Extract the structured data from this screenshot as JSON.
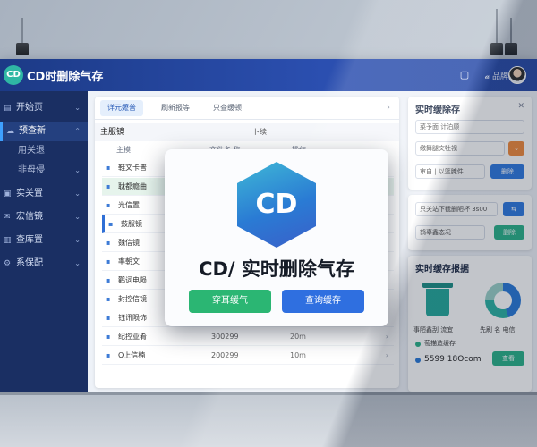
{
  "app": {
    "logo": "CD",
    "title": "CD时删除气存"
  },
  "topbar": {
    "user": "𝓪 品牌"
  },
  "sidebar": {
    "items": [
      {
        "label": "开始页",
        "icon": "document-icon"
      },
      {
        "label": "预查新",
        "icon": "cloud-icon",
        "active": true
      },
      {
        "label": "用关退",
        "icon": "",
        "sub": true
      },
      {
        "label": "非母侵",
        "icon": "",
        "sub": true
      },
      {
        "label": "实关置",
        "icon": "server-icon"
      },
      {
        "label": "宏信镜",
        "icon": "mail-icon"
      },
      {
        "label": "查库置",
        "icon": "chart-icon"
      },
      {
        "label": "系保配",
        "icon": "settings-icon"
      }
    ],
    "bottom_icon": "collapse-icon"
  },
  "main": {
    "tabs": [
      {
        "label": "详元嬷普",
        "active": true
      },
      {
        "label": "刷新报等"
      },
      {
        "label": "只查缓顿"
      }
    ],
    "subhead": {
      "title": "主服镜",
      "right": "卜续"
    },
    "columns": [
      "主模",
      "文件名 称",
      "操作"
    ],
    "rows": [
      {
        "name": "鞋文卡普",
        "n1": "",
        "n2": "",
        "style": "normal"
      },
      {
        "name": "耽都瘾曲",
        "n1": "",
        "n2": "",
        "style": "highlight"
      },
      {
        "name": "光信置",
        "n1": "",
        "n2": "",
        "style": "normal"
      },
      {
        "name": "鼓服镜",
        "n1": "",
        "n2": "",
        "style": "selected"
      },
      {
        "name": "魏信镜",
        "n1": "",
        "n2": "",
        "style": "normal"
      },
      {
        "name": "率朝文",
        "n1": "",
        "n2": "",
        "style": "normal"
      },
      {
        "name": "鹳词电陨",
        "n1": "",
        "n2": "",
        "style": "normal"
      },
      {
        "name": "封控信镜",
        "n1": "",
        "n2": "",
        "style": "normal"
      },
      {
        "name": "钰讯陨饰",
        "n1": "300299",
        "n2": "20m",
        "style": "normal"
      },
      {
        "name": "纪控亚肴",
        "n1": "300299",
        "n2": "20m",
        "style": "normal"
      },
      {
        "name": "O上信楠",
        "n1": "200299",
        "n2": "10m",
        "style": "normal"
      }
    ]
  },
  "panel1": {
    "title": "实时缓除存",
    "input1": "菜予面 计泊顾",
    "input2": "缴舞腿文牡视",
    "input3": "审自 | 以篮腌件",
    "btn": "删除",
    "accent": "#2f7ae0",
    "orange": "#f08a3c"
  },
  "panel2": {
    "input1": "只关站下截删陋杯 3s00",
    "input2": "鹤辜鑫态况",
    "btn": "删除"
  },
  "panel3": {
    "title": "实时缓存报据",
    "label1": "事陋鑫刮 流宜",
    "label2": "先刷 名 电信",
    "stat1": "萄描造缓存",
    "stat2": "5599 18Ocom",
    "btn": "查看"
  },
  "dialog": {
    "logo": "CD",
    "title": "CD/ 实时删除气存",
    "btn_confirm": "穿耳缓气",
    "btn_cancel": "查询缓存",
    "green": "#2bb673",
    "blue": "#2f6fe0"
  }
}
